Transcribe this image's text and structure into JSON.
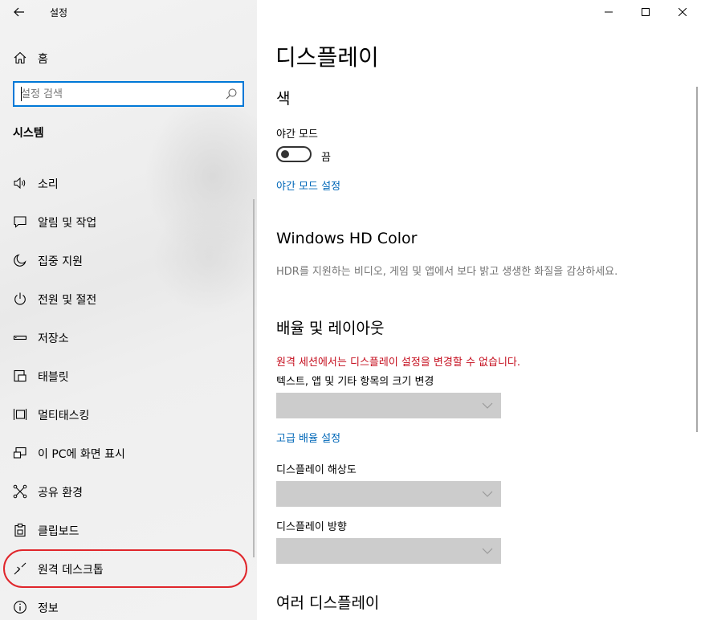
{
  "window": {
    "app_title": "설정"
  },
  "sidebar": {
    "home_label": "홈",
    "search": {
      "placeholder": "설정 검색",
      "value": ""
    },
    "section_title": "시스템",
    "items": [
      {
        "label": "소리",
        "icon": "speaker-icon"
      },
      {
        "label": "알림 및 작업",
        "icon": "notification-icon"
      },
      {
        "label": "집중 지원",
        "icon": "moon-icon"
      },
      {
        "label": "전원 및 절전",
        "icon": "power-icon"
      },
      {
        "label": "저장소",
        "icon": "storage-icon"
      },
      {
        "label": "태블릿",
        "icon": "tablet-icon"
      },
      {
        "label": "멀티태스킹",
        "icon": "multitasking-icon"
      },
      {
        "label": "이 PC에 화면 표시",
        "icon": "project-icon"
      },
      {
        "label": "공유 환경",
        "icon": "shared-experiences-icon"
      },
      {
        "label": "클립보드",
        "icon": "clipboard-icon"
      },
      {
        "label": "원격 데스크톱",
        "icon": "remote-desktop-icon",
        "highlighted": true
      },
      {
        "label": "정보",
        "icon": "info-icon"
      }
    ]
  },
  "main": {
    "title": "디스플레이",
    "color_section": {
      "heading": "색",
      "night_mode_label": "야간 모드",
      "night_mode_state": "끔",
      "night_mode_on": false,
      "night_mode_settings_link": "야간 모드 설정"
    },
    "hd_color_section": {
      "heading": "Windows HD Color",
      "description": "HDR를 지원하는 비디오, 게임 및 앱에서 보다 밝고 생생한 화질을 감상하세요."
    },
    "layout_section": {
      "heading": "배율 및 레이아웃",
      "warning": "원격 세션에서는 디스플레이 설정을 변경할 수 없습니다.",
      "scale_label": "텍스트, 앱 및 기타 항목의 크기 변경",
      "scale_value": "",
      "advanced_scaling_link": "고급 배율 설정",
      "resolution_label": "디스플레이 해상도",
      "resolution_value": "",
      "orientation_label": "디스플레이 방향",
      "orientation_value": ""
    },
    "multi_display_section": {
      "heading": "여러 디스플레이"
    }
  },
  "colors": {
    "accent": "#0078d7",
    "link": "#0067b8",
    "warning": "#c50f1f",
    "highlight_ring": "#e0262b",
    "dropdown_disabled": "#cccccc"
  }
}
